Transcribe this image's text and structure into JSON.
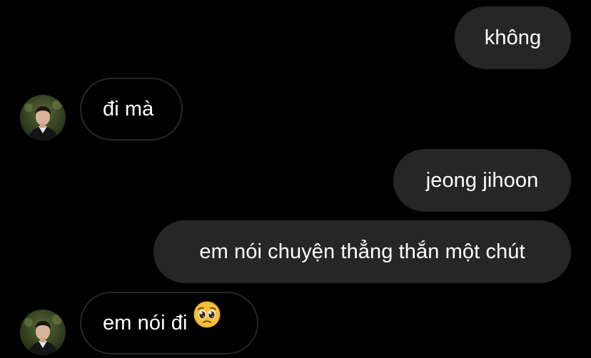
{
  "thread": {
    "messages": [
      {
        "from": "me",
        "text": "không"
      },
      {
        "from": "them",
        "text": "đi mà"
      },
      {
        "from": "me",
        "text": "jeong jihoon"
      },
      {
        "from": "me",
        "text": "em nói chuyện thẳng thắn một chút"
      },
      {
        "from": "them",
        "text": "em nói đi",
        "emoji": "pleading-face-emoji"
      }
    ]
  },
  "colors": {
    "background": "#000000",
    "sent_bubble": "#262626",
    "received_border": "#262626",
    "text": "#ffffff",
    "emoji": "#f7c137"
  }
}
